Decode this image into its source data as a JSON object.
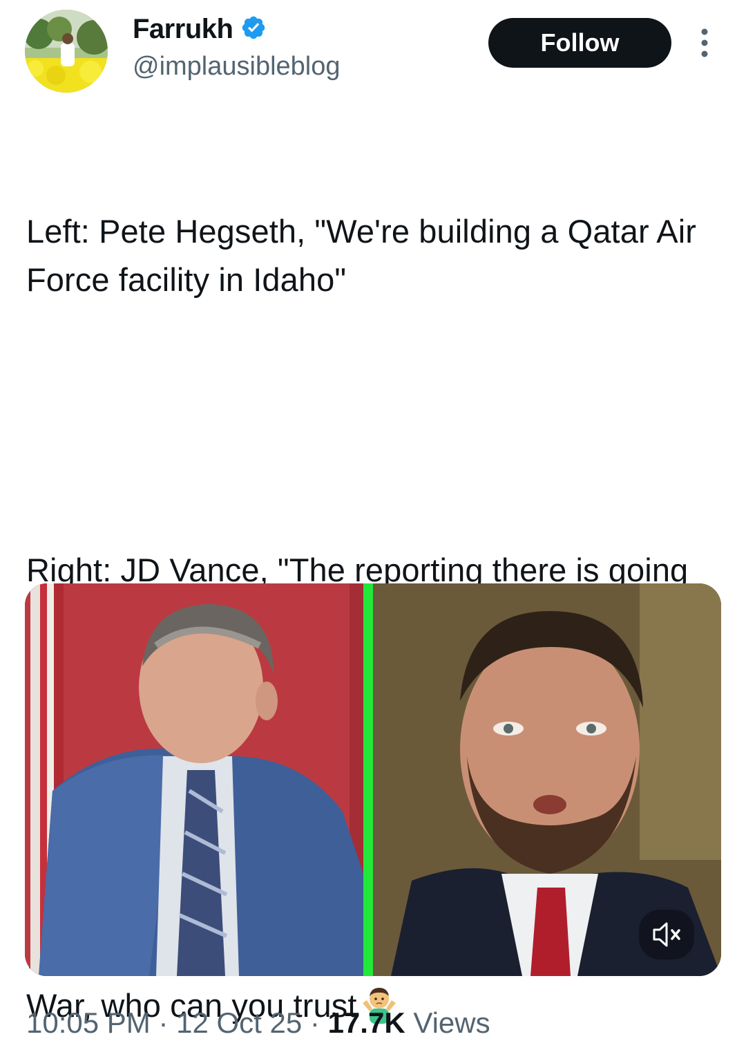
{
  "author": {
    "display_name": "Farrukh",
    "handle": "@implausibleblog",
    "verified": true
  },
  "follow_label": "Follow",
  "tweet": {
    "lines": [
      "Left: Pete Hegseth, \"We're building a Qatar Air Force facility in Idaho\"",
      "Right: JD Vance, \"The reporting there is going to be a Qatari base on US soil, that's just not true\"",
      "If you can't trust the United States Secretary of War, who can you trust"
    ],
    "emoji": "man-shrugging-emoji"
  },
  "media": {
    "type": "video",
    "divider_color": "#22e83a",
    "muted": true
  },
  "meta": {
    "time": "10:05 PM",
    "separator": "·",
    "date": "12 Oct 25",
    "views_count": "17.7K",
    "views_label": "Views"
  },
  "colors": {
    "text": "#0f1419",
    "secondary": "#536471",
    "verified": "#1d9bf0",
    "follow_bg": "#0f1419"
  }
}
